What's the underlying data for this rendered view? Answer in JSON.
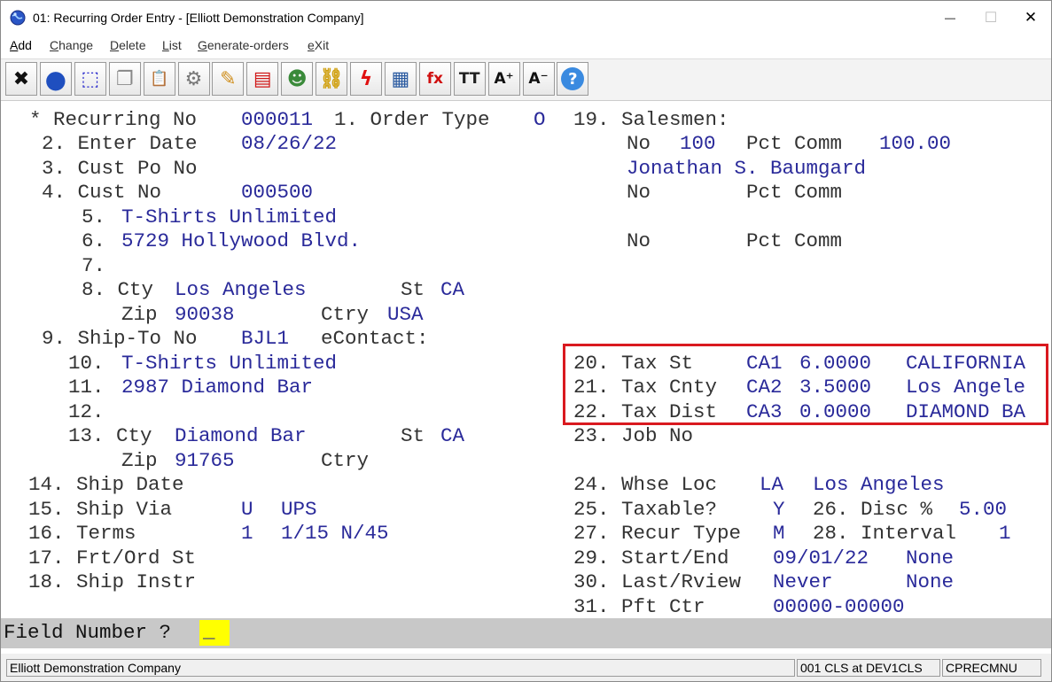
{
  "window": {
    "title": "01: Recurring Order Entry - [Elliott Demonstration Company]",
    "minimize_glyph": "—",
    "maximize_glyph": "☐",
    "close_glyph": "✕"
  },
  "menu": [
    "Add",
    "Change",
    "Delete",
    "List",
    "Generate-orders",
    "eXit"
  ],
  "toolbar": [
    {
      "icon": "close-x-icon",
      "glyph": "✖",
      "color": "#111111"
    },
    {
      "icon": "globe-icon",
      "glyph": "●",
      "color": "#1f4fbf"
    },
    {
      "icon": "select-box-icon",
      "glyph": "⬚",
      "color": "#2a2acc"
    },
    {
      "icon": "copy-icon",
      "glyph": "❐",
      "color": "#888888"
    },
    {
      "icon": "paste-icon",
      "glyph": "📋",
      "color": "#888888"
    },
    {
      "icon": "gear-icon",
      "glyph": "⚙",
      "color": "#777777"
    },
    {
      "icon": "edit-pencil-icon",
      "glyph": "✎",
      "color": "#d09020"
    },
    {
      "icon": "calendar-icon",
      "glyph": "▤",
      "color": "#d01818"
    },
    {
      "icon": "users-icon",
      "glyph": "☻",
      "color": "#3a8a3a"
    },
    {
      "icon": "link-icon",
      "glyph": "⛓",
      "color": "#d0a010"
    },
    {
      "icon": "lightning-icon",
      "glyph": "ϟ",
      "color": "#e01010"
    },
    {
      "icon": "report-icon",
      "glyph": "▦",
      "color": "#2a5aa0"
    },
    {
      "icon": "function-icon",
      "glyph": "fx",
      "color": "#d01010"
    },
    {
      "icon": "font-size-icon",
      "glyph": "TT",
      "color": "#222222"
    },
    {
      "icon": "font-increase-icon",
      "glyph": "A⁺",
      "color": "#111111"
    },
    {
      "icon": "font-decrease-icon",
      "glyph": "A⁻",
      "color": "#111111"
    },
    {
      "icon": "help-icon",
      "glyph": "?",
      "color": "#ffffff"
    }
  ],
  "form": {
    "lbl_recurring_no": "* Recurring No",
    "val_recurring_no": "000011",
    "lbl_order_type": "1. Order Type",
    "val_order_type": "O",
    "lbl_enter_date": "2. Enter Date",
    "val_enter_date": "08/26/22",
    "lbl_cust_po": "3. Cust Po No",
    "lbl_cust_no": "4. Cust No",
    "val_cust_no": "000500",
    "lbl_f5": "5.",
    "val_f5": "T-Shirts Unlimited",
    "lbl_f6": "6.",
    "val_f6": "5729 Hollywood Blvd.",
    "lbl_f7": "7.",
    "lbl_f8_cty": "8. Cty",
    "val_f8_cty": "Los Angeles",
    "lbl_f8_st": "St",
    "val_f8_st": "CA",
    "lbl_zip1": "Zip",
    "val_zip1": "90038",
    "lbl_ctry1": "Ctry",
    "val_ctry1": "USA",
    "lbl_f9": "9. Ship-To No",
    "val_f9": "BJL1",
    "lbl_econtact": "eContact:",
    "lbl_f10": "10.",
    "val_f10": "T-Shirts Unlimited",
    "lbl_f11": "11.",
    "val_f11": "2987 Diamond Bar",
    "lbl_f12": "12.",
    "lbl_f13_cty": "13. Cty",
    "val_f13_cty": "Diamond Bar",
    "lbl_f13_st": "St",
    "val_f13_st": "CA",
    "lbl_zip2": "Zip",
    "val_zip2": "91765",
    "lbl_ctry2": "Ctry",
    "lbl_f14": "14. Ship Date",
    "lbl_f15": "15. Ship Via",
    "val_f15_code": "U",
    "val_f15_desc": "UPS",
    "lbl_f16": "16. Terms",
    "val_f16_code": "1",
    "val_f16_desc": "1/15 N/45",
    "lbl_f17": "17. Frt/Ord St",
    "lbl_f18": "18. Ship Instr",
    "lbl_f19": "19. Salesmen:",
    "lbl_no1": "No",
    "val_no1": "100",
    "lbl_pct1": "Pct Comm",
    "val_pct1": "100.00",
    "val_salesman_name": "Jonathan S. Baumgard",
    "lbl_no2": "No",
    "lbl_pct2": "Pct Comm",
    "lbl_no3": "No",
    "lbl_pct3": "Pct Comm",
    "lbl_f20": "20. Tax St",
    "val_f20_code": "CA1",
    "val_f20_rate": "6.0000",
    "val_f20_name": "CALIFORNIA",
    "lbl_f21": "21. Tax Cnty",
    "val_f21_code": "CA2",
    "val_f21_rate": "3.5000",
    "val_f21_name": "Los Angele",
    "lbl_f22": "22. Tax Dist",
    "val_f22_code": "CA3",
    "val_f22_rate": "0.0000",
    "val_f22_name": "DIAMOND BA",
    "lbl_f23": "23. Job No",
    "lbl_f24": "24. Whse Loc",
    "val_f24_code": "LA",
    "val_f24_name": "Los Angeles",
    "lbl_f25": "25. Taxable?",
    "val_f25": "Y",
    "lbl_f26": "26. Disc %",
    "val_f26": "5.00",
    "lbl_f27": "27. Recur Type",
    "val_f27": "M",
    "lbl_f28": "28. Interval",
    "val_f28": "1",
    "lbl_f29": "29. Start/End",
    "val_f29_start": "09/01/22",
    "val_f29_end": "None",
    "lbl_f30": "30. Last/Rview",
    "val_f30_last": "Never",
    "val_f30_review": "None",
    "lbl_f31": "31. Pft Ctr",
    "val_f31": "00000-00000"
  },
  "prompt": {
    "label": "Field Number ?",
    "cursor": "_"
  },
  "status": {
    "company": "Elliott Demonstration Company",
    "session": "001 CLS at DEV1CLS",
    "menu_code": "CPRECMNU"
  },
  "colors": {
    "highlight_box": "#d9191f",
    "value_text": "#2a2a9a",
    "label_text": "#333333",
    "prompt_cursor_bg": "#ffff00"
  }
}
